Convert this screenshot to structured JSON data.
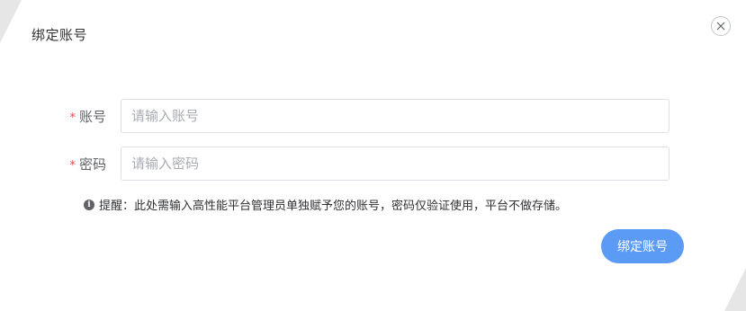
{
  "dialog": {
    "title": "绑定账号",
    "close_icon": "close-icon"
  },
  "form": {
    "required_mark": "*",
    "account": {
      "label": "账号",
      "value": "",
      "placeholder": "请输入账号"
    },
    "password": {
      "label": "密码",
      "value": "",
      "placeholder": "请输入密码"
    },
    "hint": {
      "icon": "info-circle-icon",
      "icon_glyph": "i",
      "text": "提醒：此处需输入高性能平台管理员单独赋予您的账号，密码仅验证使用，平台不做存储。"
    },
    "submit_label": "绑定账号"
  },
  "colors": {
    "primary_button": "#5b9bf5",
    "required": "#e5484d",
    "border": "#dcdfe6"
  }
}
